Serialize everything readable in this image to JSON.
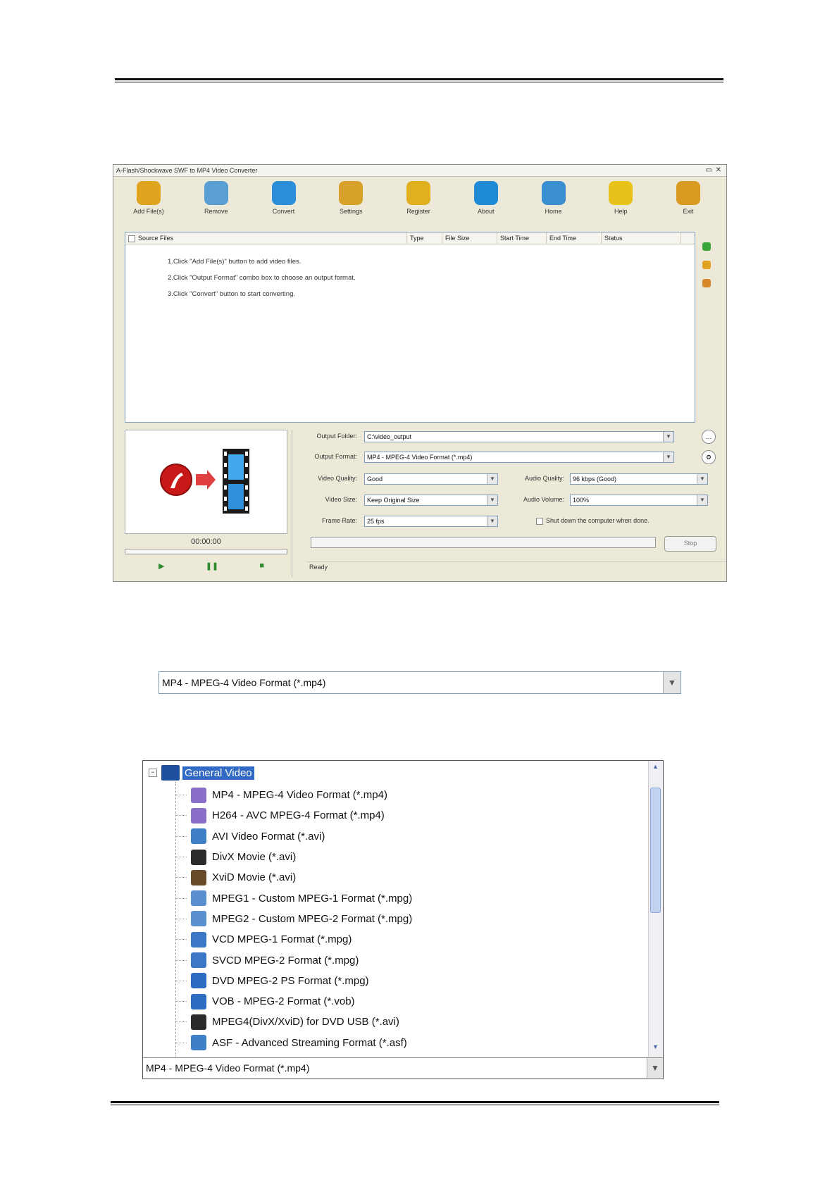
{
  "app": {
    "title": "A-Flash/Shockwave SWF to MP4 Video Converter",
    "window_controls": "▭ ✕",
    "toolbar": [
      {
        "name": "add-files",
        "label": "Add File(s)",
        "icon": "add-files-icon",
        "color": "#e0a51e"
      },
      {
        "name": "remove",
        "label": "Remove",
        "icon": "trash-icon",
        "color": "#5a9fd4"
      },
      {
        "name": "convert",
        "label": "Convert",
        "icon": "convert-icon",
        "color": "#2a8fd8"
      },
      {
        "name": "settings",
        "label": "Settings",
        "icon": "gear-icon",
        "color": "#d8a22a"
      },
      {
        "name": "register",
        "label": "Register",
        "icon": "key-icon",
        "color": "#e0b020"
      },
      {
        "name": "about",
        "label": "About",
        "icon": "about-icon",
        "color": "#1f8ad6"
      },
      {
        "name": "home",
        "label": "Home",
        "icon": "home-icon",
        "color": "#3a8fd0"
      },
      {
        "name": "help",
        "label": "Help",
        "icon": "help-icon",
        "color": "#e6c21a"
      },
      {
        "name": "exit",
        "label": "Exit",
        "icon": "exit-icon",
        "color": "#d89a20"
      }
    ],
    "filelist": {
      "columns": [
        "Source Files",
        "Type",
        "File Size",
        "Start Time",
        "End Time",
        "Status"
      ],
      "steps": [
        "1.Click \"Add File(s)\" button to add video files.",
        "2.Click \"Output Format\" combo box to choose an output format.",
        "3.Click \"Convert\" button to start converting."
      ]
    },
    "side_icons": [
      "add-icon",
      "delete-icon",
      "clear-icon"
    ],
    "preview": {
      "time": "00:00:00",
      "controls": [
        "▶",
        "❚❚",
        "■"
      ]
    },
    "output": {
      "folder_label": "Output Folder:",
      "folder_value": "C:\\video_output",
      "format_label": "Output Format:",
      "format_value": "MP4 - MPEG-4 Video Format (*.mp4)",
      "video_quality_label": "Video Quality:",
      "video_quality_value": "Good",
      "audio_quality_label": "Audio Quality:",
      "audio_quality_value": "96 kbps (Good)",
      "video_size_label": "Video Size:",
      "video_size_value": "Keep Original Size",
      "audio_volume_label": "Audio Volume:",
      "audio_volume_value": "100%",
      "frame_rate_label": "Frame Rate:",
      "frame_rate_value": "25 fps",
      "shutdown_label": "Shut down the computer when done.",
      "stop_label": "Stop",
      "status_text": "Ready"
    }
  },
  "format_combo": {
    "value": "MP4 - MPEG-4 Video Format (*.mp4)"
  },
  "format_tree": {
    "category": "General Video",
    "items": [
      {
        "label": "MP4 - MPEG-4 Video Format (*.mp4)",
        "icon": "mp4-icon",
        "color": "#8a6fc9"
      },
      {
        "label": "H264 - AVC MPEG-4 Format (*.mp4)",
        "icon": "h264-icon",
        "color": "#8a6fc9"
      },
      {
        "label": "AVI Video Format (*.avi)",
        "icon": "avi-icon",
        "color": "#3e7fc8"
      },
      {
        "label": "DivX Movie (*.avi)",
        "icon": "divx-icon",
        "color": "#2c2c2c"
      },
      {
        "label": "XviD Movie (*.avi)",
        "icon": "xvid-icon",
        "color": "#6b4a2a"
      },
      {
        "label": "MPEG1 - Custom MPEG-1 Format (*.mpg)",
        "icon": "mpeg1-icon",
        "color": "#5a8fd0"
      },
      {
        "label": "MPEG2 - Custom MPEG-2 Format (*.mpg)",
        "icon": "mpeg2-icon",
        "color": "#5a8fd0"
      },
      {
        "label": "VCD MPEG-1 Format (*.mpg)",
        "icon": "vcd-icon",
        "color": "#3a78c6"
      },
      {
        "label": "SVCD MPEG-2 Format (*.mpg)",
        "icon": "svcd-icon",
        "color": "#3a78c6"
      },
      {
        "label": "DVD MPEG-2 PS Format (*.mpg)",
        "icon": "dvd-icon",
        "color": "#2d6cc0"
      },
      {
        "label": "VOB - MPEG-2 Format (*.vob)",
        "icon": "vob-icon",
        "color": "#2d6cc0"
      },
      {
        "label": "MPEG4(DivX/XviD) for DVD USB (*.avi)",
        "icon": "mpeg4-dvd-icon",
        "color": "#2c2c2c"
      },
      {
        "label": "ASF - Advanced Streaming Format (*.asf)",
        "icon": "asf-icon",
        "color": "#3e7fc8"
      }
    ],
    "selected": "MP4 - MPEG-4 Video Format (*.mp4)"
  }
}
